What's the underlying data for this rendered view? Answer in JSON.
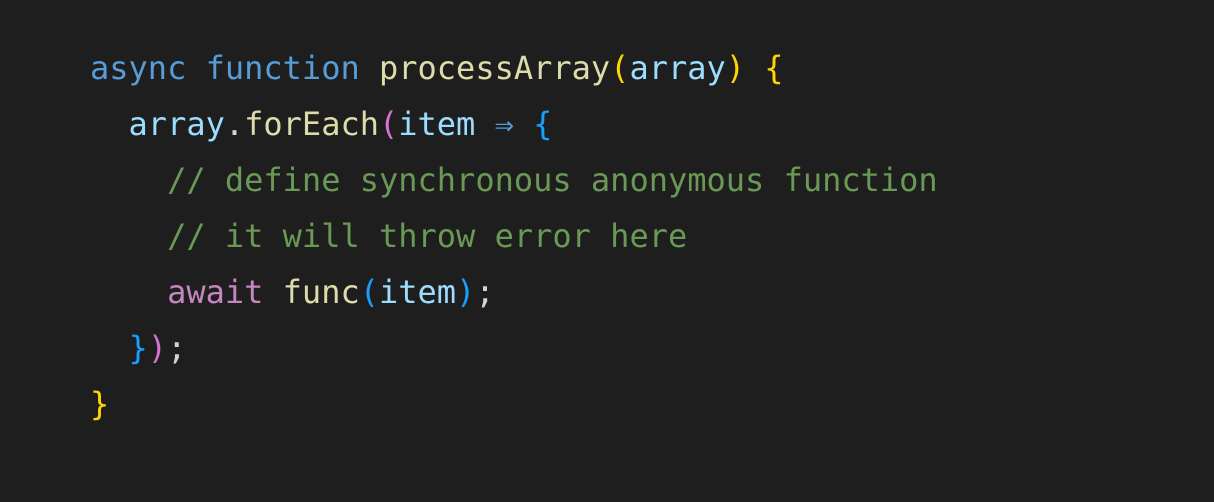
{
  "code": {
    "line1": {
      "async": "async",
      "function": "function",
      "fnName": "processArray",
      "openParen": "(",
      "param": "array",
      "closeParen": ")",
      "space": " ",
      "openBrace": "{"
    },
    "line2": {
      "indent": "  ",
      "obj": "array",
      "dot": ".",
      "method": "forEach",
      "openParen": "(",
      "param": "item",
      "arrow": " ⇒ ",
      "openBrace": "{"
    },
    "line3": {
      "indent": "    ",
      "comment": "// define synchronous anonymous function"
    },
    "line4": {
      "indent": "    ",
      "comment": "// it will throw error here"
    },
    "line5": {
      "indent": "    ",
      "await": "await",
      "space": " ",
      "fn": "func",
      "openParen": "(",
      "arg": "item",
      "closeParen": ")",
      "semi": ";"
    },
    "line6": {
      "indent": "  ",
      "closeBrace": "}",
      "closeParen": ")",
      "semi": ";"
    },
    "line7": {
      "closeBrace": "}"
    }
  }
}
